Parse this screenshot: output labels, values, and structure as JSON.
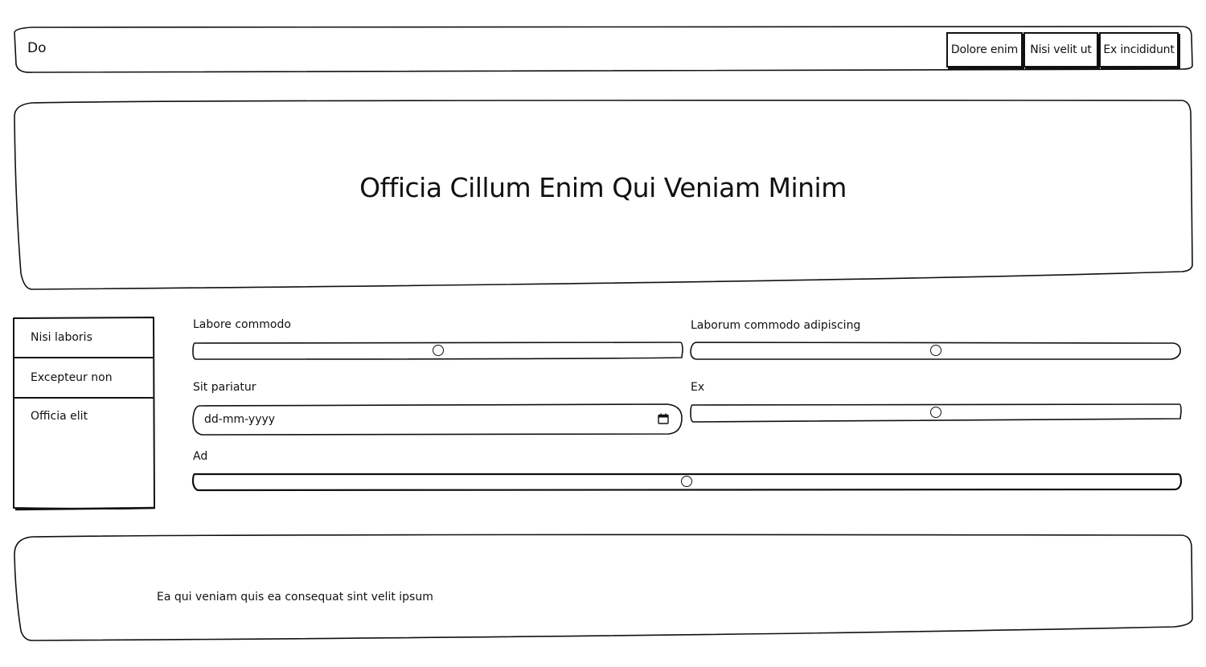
{
  "header": {
    "brand": "Do",
    "nav": [
      {
        "label": "Dolore enim"
      },
      {
        "label": "Nisi velit ut"
      },
      {
        "label": "Ex incididunt"
      }
    ]
  },
  "hero": {
    "title": "Officia Cillum Enim Qui Veniam Minim"
  },
  "sidebar": {
    "items": [
      {
        "label": "Nisi laboris"
      },
      {
        "label": "Excepteur non"
      },
      {
        "label": "Officia elit"
      }
    ]
  },
  "form": {
    "labore_commodo": {
      "label": "Labore commodo",
      "value_fraction": 0.5
    },
    "laborum_commodo": {
      "label": "Laborum commodo adipiscing",
      "value_fraction": 0.5
    },
    "sit_pariatur": {
      "label": "Sit pariatur",
      "placeholder": "dd-mm-yyyy"
    },
    "ex": {
      "label": "Ex",
      "value_fraction": 0.5
    },
    "ad": {
      "label": "Ad",
      "value_fraction": 0.5
    }
  },
  "footer": {
    "text": "Ea qui veniam quis ea consequat sint velit ipsum"
  },
  "colors": {
    "ink": "#111111",
    "background": "#ffffff"
  },
  "icons": {
    "date_picker": "calendar-icon"
  }
}
